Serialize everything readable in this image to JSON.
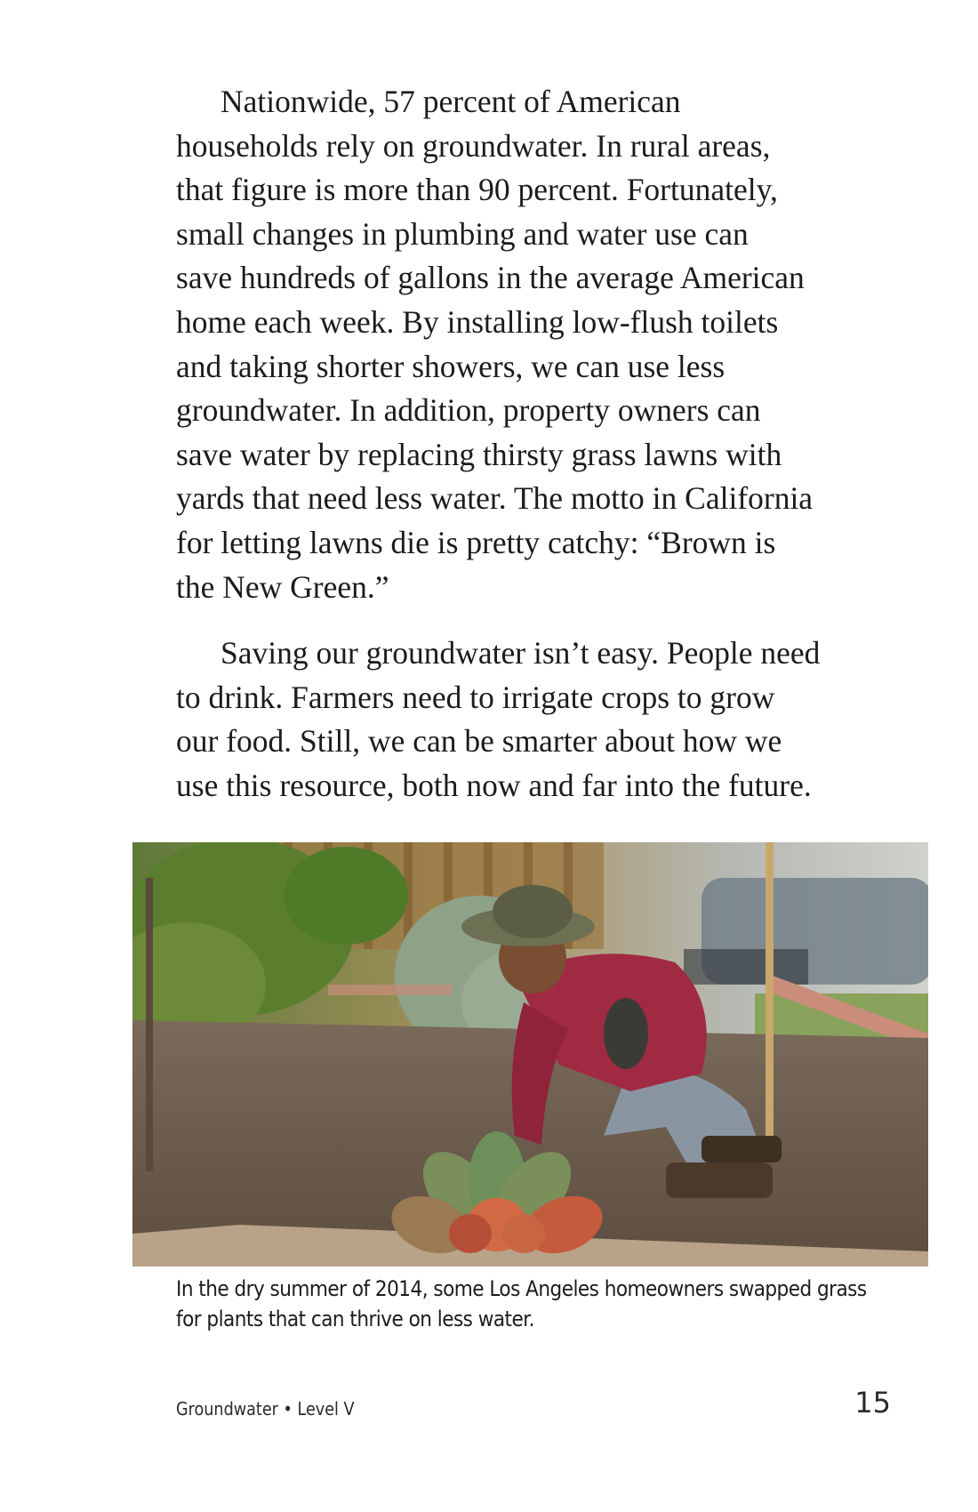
{
  "paragraphs": [
    {
      "lines": [
        "Nationwide, 57 percent of American",
        "households rely on groundwater. In rural areas,",
        "that figure is more than 90 percent. Fortunately,",
        "small changes in plumbing and water use can",
        "save hundreds of gallons in the average American",
        "home each week. By installing low-flush toilets",
        "and taking shorter showers, we can use less",
        "groundwater. In addition, property owners can",
        "save water by replacing thirsty grass lawns with",
        "yards that need less water. The motto in California",
        "for letting lawns die is pretty catchy: “Brown is",
        "the New Green.”"
      ]
    },
    {
      "lines": [
        "Saving our groundwater isn’t easy. People need",
        "to drink. Farmers need to irrigate crops to grow",
        "our food. Still, we can be smarter about how we",
        "use this resource, both now and far into the future."
      ]
    }
  ],
  "photo": {
    "subject": "man-planting-succulent-in-yard"
  },
  "caption": {
    "lines": [
      "In the dry summer of 2014, some Los Angeles homeowners swapped grass",
      "for plants that can thrive on less water."
    ]
  },
  "footer": {
    "book_title": "Groundwater • Level V",
    "page_number": "15"
  }
}
